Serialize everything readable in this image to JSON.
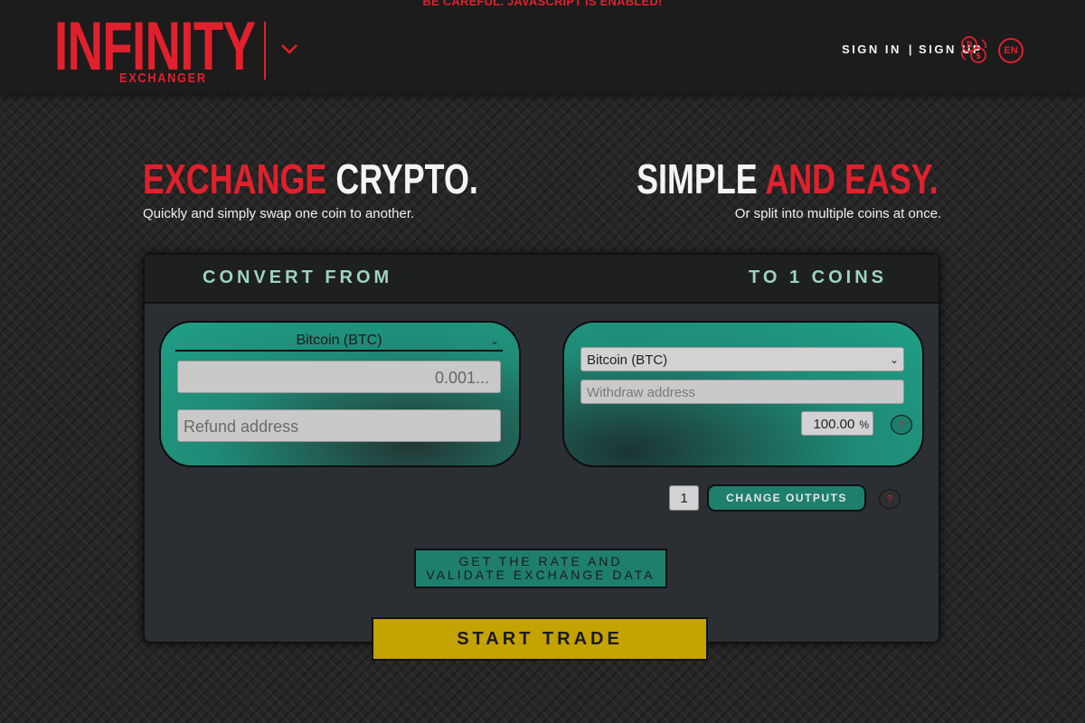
{
  "header": {
    "warning": "BE CAREFUL. JAVASCRIPT IS ENABLED!",
    "logo_main": "INFINITY",
    "logo_sub": "EXCHANGER",
    "sign_in": "SIGN IN",
    "separator": "|",
    "sign_up": "SIGN UP",
    "language": "EN"
  },
  "hero": {
    "left_title_red": "EXCHANGE",
    "left_title_white": "CRYPTO.",
    "left_subtitle": "Quickly and simply swap one coin to another.",
    "right_title_white": "SIMPLE",
    "right_title_red": "AND EASY.",
    "right_subtitle": "Or split into multiple coins at once."
  },
  "panel": {
    "convert_from": "CONVERT FROM",
    "to_coins": "TO 1 COINS",
    "from": {
      "coin": "Bitcoin (BTC)",
      "amount_placeholder": "0.001...",
      "refund_placeholder": "Refund address"
    },
    "to": {
      "coin": "Bitcoin (BTC)",
      "withdraw_placeholder": "Withdraw address",
      "percent": "100.00",
      "percent_sign": "%"
    },
    "help": "?",
    "outputs_count": "1",
    "change_outputs": "CHANGE OUTPUTS",
    "validate_line1": "GET THE RATE AND",
    "validate_line2": "VALIDATE EXCHANGE DATA",
    "start_trade": "START TRADE"
  },
  "colors": {
    "accent_red": "#e0212d",
    "teal": "#1f8a76",
    "start_yellow": "#c4a200",
    "header_bg": "#1c1c1c"
  }
}
